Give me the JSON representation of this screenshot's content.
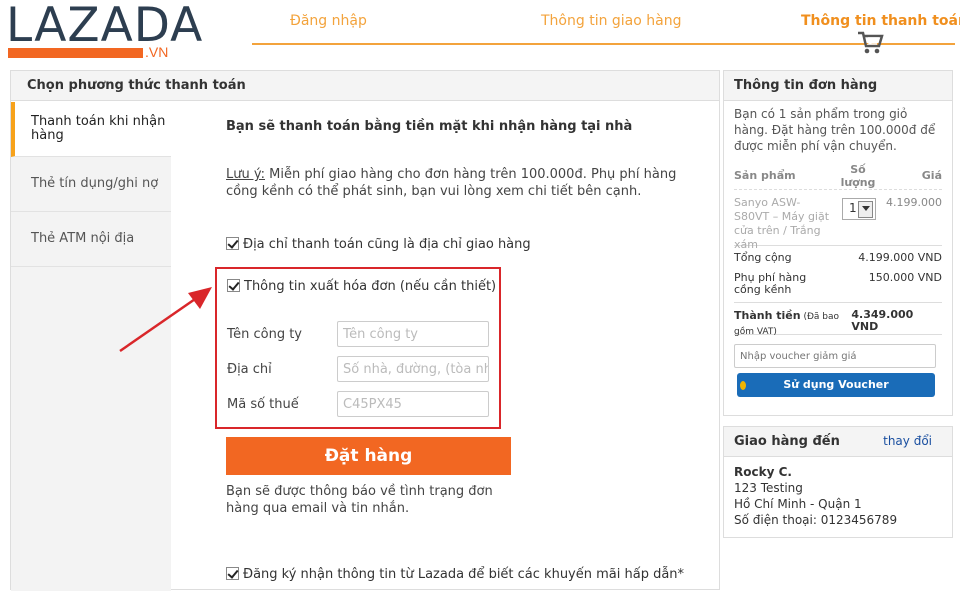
{
  "brand": {
    "name": "LAZADA",
    "domain": ".VN",
    "color_primary": "#2d3e50",
    "color_accent": "#f26722"
  },
  "steps": [
    {
      "label": "Đăng nhập"
    },
    {
      "label": "Thông tin giao hàng"
    },
    {
      "label": "Thông tin thanh toán",
      "active": true
    }
  ],
  "payment": {
    "header": "Chọn phương thức thanh toán",
    "tabs": [
      {
        "label": "Thanh toán khi nhận hàng",
        "active": true
      },
      {
        "label": "Thẻ tín dụng/ghi nợ"
      },
      {
        "label": "Thẻ ATM nội địa"
      }
    ],
    "title": "Bạn sẽ thanh toán bằng tiền mặt khi nhận hàng tại nhà",
    "note_label": "Lưu ý:",
    "note_text": " Miễn phí giao hàng cho đơn hàng trên 100.000đ. Phụ phí hàng cồng kềnh có thể phát sinh, bạn vui lòng xem chi tiết bên cạnh.",
    "same_address_label": "Địa chỉ thanh toán cũng là địa chỉ giao hàng",
    "invoice": {
      "check_label": "Thông tin xuất hóa đơn (nếu cần thiết)",
      "fields": [
        {
          "label": "Tên công ty",
          "placeholder": "Tên công ty"
        },
        {
          "label": "Địa chỉ",
          "placeholder": "Số nhà, đường, (tòa nhà)"
        },
        {
          "label": "Mã số thuế",
          "placeholder": "C45PX45"
        }
      ]
    },
    "order_button": "Đặt hàng",
    "notify_text": "Bạn sẽ được thông báo về tình trạng đơn hàng qua email và tin nhắn.",
    "newsletter_label": "Đăng ký nhận thông tin từ Lazada để biết các khuyến mãi hấp dẫn*"
  },
  "order": {
    "header": "Thông tin đơn hàng",
    "summary": "Bạn có 1 sản phẩm trong giỏ hàng. Đặt hàng trên 100.000đ để được miễn phí vận chuyển.",
    "columns": {
      "product": "Sản phẩm",
      "qty": "Số lượng",
      "price": "Giá"
    },
    "item": {
      "name": "Sanyo ASW-S80VT – Máy giặt cửa trên / Trắng xám",
      "qty": "1",
      "price": "4.199.000"
    },
    "totals": [
      {
        "label": "Tổng cộng",
        "value": "4.199.000 VND"
      },
      {
        "label": "Phụ phí hàng cồng kềnh",
        "value": "150.000 VND"
      }
    ],
    "grand_label": "Thành tiền",
    "grand_note": " (Đã bao gồm VAT)",
    "grand_value": "4.349.000 VND",
    "voucher_placeholder": "Nhập voucher giảm giá",
    "voucher_button": "Sử dụng Voucher"
  },
  "shipping": {
    "header": "Giao hàng đến",
    "change_link": "thay đổi",
    "name": "Rocky C.",
    "address1": "123 Testing",
    "address2": "Hồ Chí Minh - Quận 1",
    "phone": "Số điện thoại: 0123456789"
  }
}
